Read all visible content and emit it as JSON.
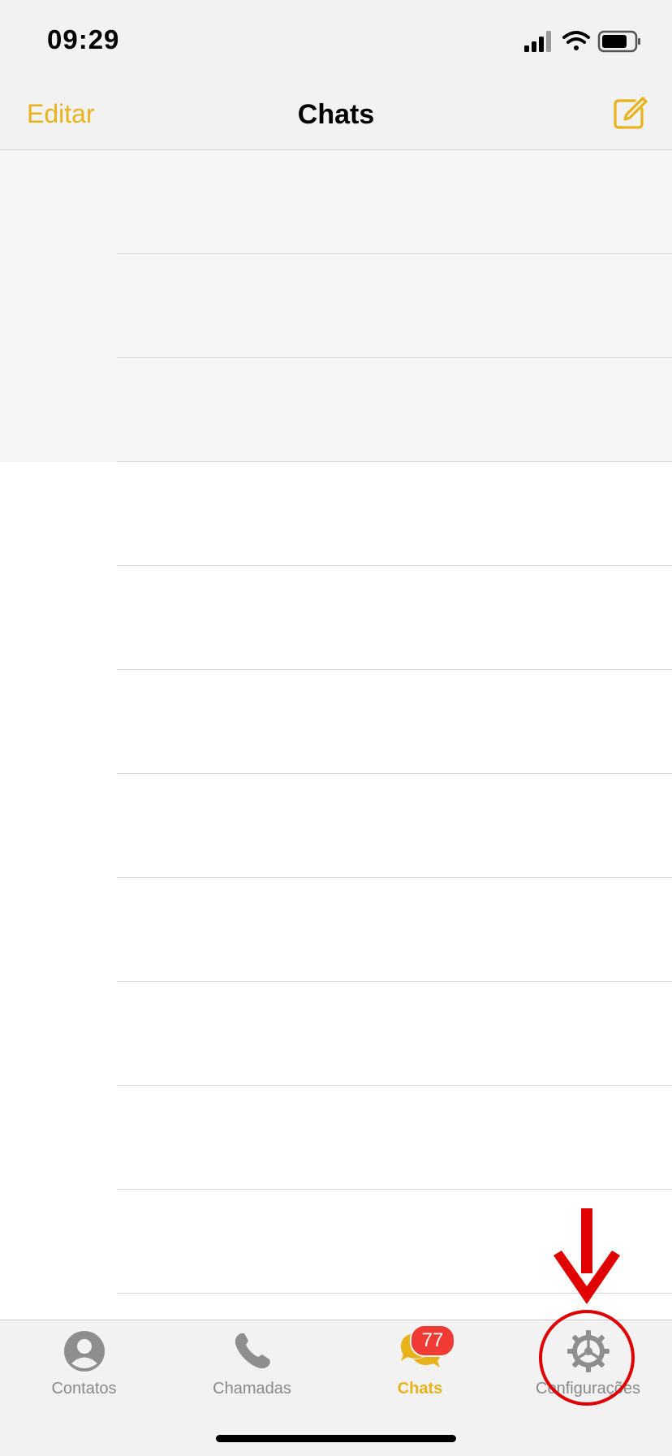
{
  "status": {
    "time": "09:29",
    "icons": [
      "signal-icon",
      "wifi-icon",
      "battery-icon"
    ]
  },
  "header": {
    "edit_label": "Editar",
    "title": "Chats",
    "compose_icon": "compose-icon"
  },
  "tabs": [
    {
      "label": "Contatos",
      "icon": "contact-icon"
    },
    {
      "label": "Chamadas",
      "icon": "phone-icon"
    },
    {
      "label": "Chats",
      "icon": "chat-bubbles-icon",
      "badge": "77"
    },
    {
      "label": "Configurações",
      "icon": "gear-icon"
    }
  ],
  "colors": {
    "accent": "#e8b31a",
    "badge": "#ef3b34",
    "annotation": "#e00000"
  }
}
